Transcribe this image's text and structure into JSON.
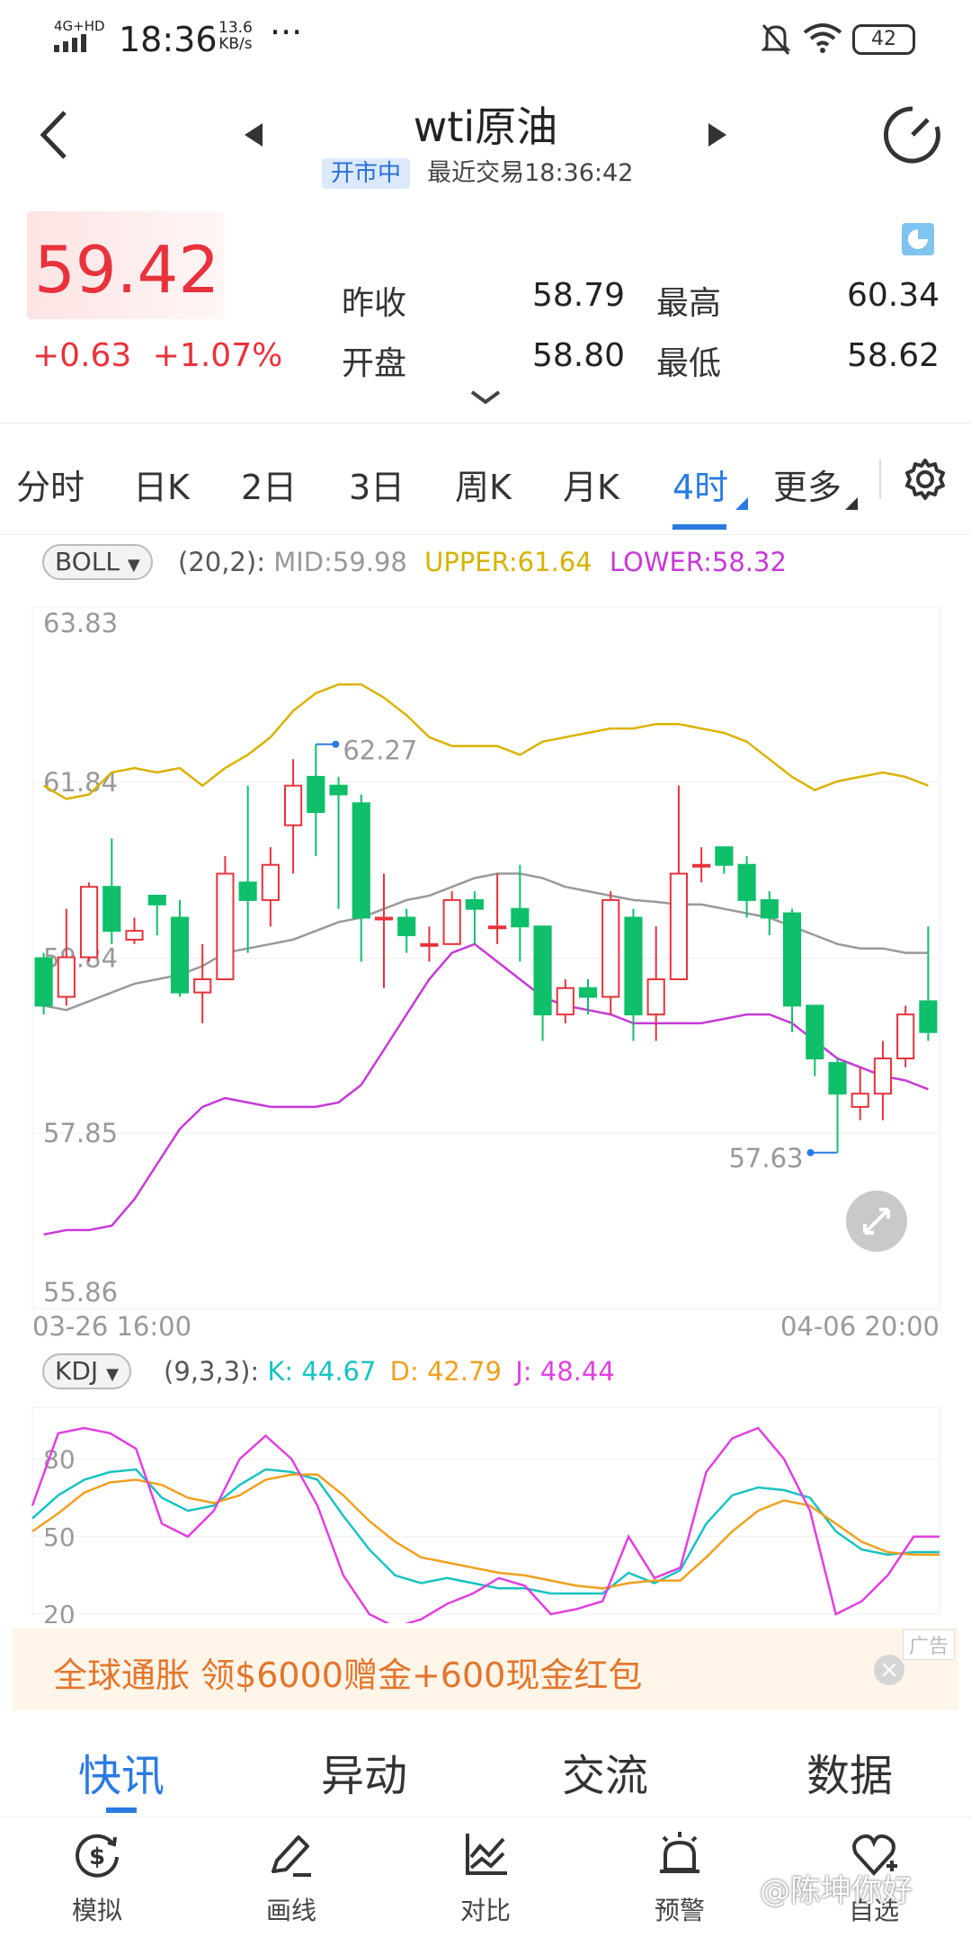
{
  "status_bar": {
    "network": "4G+HD",
    "time": "18:36",
    "speed_value": "13.6",
    "speed_unit": "KB/s",
    "more": "···",
    "battery": "42"
  },
  "header": {
    "title": "wti原油",
    "market_status": "开市中",
    "last_trade": "最近交易18:36:42"
  },
  "quote": {
    "price": "59.42",
    "change": "+0.63",
    "change_pct": "+1.07%",
    "prev_close_label": "昨收",
    "prev_close": "58.79",
    "high_label": "最高",
    "high": "60.34",
    "open_label": "开盘",
    "open": "58.80",
    "low_label": "最低",
    "low": "58.62"
  },
  "period_tabs": [
    "分时",
    "日K",
    "2日",
    "3日",
    "周K",
    "月K",
    "4时",
    "更多"
  ],
  "active_period": 6,
  "boll": {
    "indicator": "BOLL",
    "params": "(20,2):",
    "mid": "MID:59.98",
    "upper": "UPPER:61.64",
    "lower": "LOWER:58.32",
    "y_labels": [
      "63.83",
      "61.84",
      "59.84",
      "57.85",
      "55.86"
    ],
    "max_label": "62.27",
    "min_label": "57.63",
    "start_time": "03-26 16:00",
    "end_time": "04-06 20:00"
  },
  "kdj": {
    "indicator": "KDJ",
    "params": "(9,3,3):",
    "k": "K: 44.67",
    "d": "D: 42.79",
    "j": "J: 48.44",
    "y_labels": [
      "80",
      "50",
      "20"
    ]
  },
  "ad": {
    "text": "全球通胀 领$6000赠金+600现金红包",
    "tag": "广告"
  },
  "news_tabs": [
    "快讯",
    "异动",
    "交流",
    "数据"
  ],
  "toolbar": [
    {
      "label": "模拟",
      "icon": "dollar-refresh-icon"
    },
    {
      "label": "画线",
      "icon": "pencil-icon"
    },
    {
      "label": "对比",
      "icon": "compare-chart-icon"
    },
    {
      "label": "预警",
      "icon": "alarm-bell-icon"
    },
    {
      "label": "自选",
      "icon": "heart-plus-icon"
    }
  ],
  "watermark": "@陈坤你好",
  "colors": {
    "up": "#e8323c",
    "down": "#0fbf6a",
    "accent": "#2a7ae2",
    "upper": "#d9b300",
    "lower": "#c63ad6",
    "mid": "#999999",
    "k": "#19c2c2",
    "d": "#f0a020",
    "j": "#e040e0"
  },
  "chart_data": [
    {
      "type": "candlestick",
      "title": "wti原油 4时 BOLL(20,2)",
      "ylim": [
        55.86,
        63.83
      ],
      "y_ticks": [
        63.83,
        61.84,
        59.84,
        57.85,
        55.86
      ],
      "x_start": "03-26 16:00",
      "x_end": "04-06 20:00",
      "candles": [
        [
          59.84,
          59.3,
          59.9,
          59.2
        ],
        [
          59.4,
          59.85,
          60.4,
          59.3
        ],
        [
          59.85,
          60.65,
          60.7,
          59.8
        ],
        [
          60.65,
          60.15,
          61.2,
          60.0
        ],
        [
          60.05,
          60.15,
          60.3,
          60.0
        ],
        [
          60.55,
          60.45,
          60.55,
          60.1
        ],
        [
          60.3,
          59.45,
          60.5,
          59.4
        ],
        [
          59.45,
          59.6,
          60.0,
          59.1
        ],
        [
          59.6,
          60.8,
          61.0,
          59.6
        ],
        [
          60.7,
          60.5,
          61.8,
          59.9
        ],
        [
          60.5,
          60.9,
          61.1,
          60.2
        ],
        [
          61.35,
          61.8,
          62.1,
          60.8
        ],
        [
          61.9,
          61.5,
          62.27,
          61.0
        ],
        [
          61.8,
          61.7,
          61.9,
          60.4
        ],
        [
          61.6,
          60.3,
          61.7,
          59.8
        ],
        [
          60.3,
          60.3,
          60.8,
          59.5
        ],
        [
          60.3,
          60.1,
          60.4,
          59.9
        ],
        [
          60.0,
          60.0,
          60.2,
          59.8
        ],
        [
          60.0,
          60.5,
          60.6,
          60.0
        ],
        [
          60.5,
          60.4,
          60.6,
          60.0
        ],
        [
          60.2,
          60.2,
          60.8,
          60.0
        ],
        [
          60.4,
          60.2,
          60.9,
          59.8
        ],
        [
          60.2,
          59.2,
          60.2,
          58.9
        ],
        [
          59.2,
          59.5,
          59.6,
          59.1
        ],
        [
          59.5,
          59.4,
          59.6,
          59.2
        ],
        [
          59.4,
          60.5,
          60.6,
          59.2
        ],
        [
          60.3,
          59.2,
          60.4,
          58.9
        ],
        [
          59.2,
          59.6,
          60.2,
          58.9
        ],
        [
          59.6,
          60.8,
          61.8,
          59.6
        ],
        [
          60.9,
          60.9,
          61.1,
          60.7
        ],
        [
          61.1,
          60.9,
          61.1,
          60.8
        ],
        [
          60.9,
          60.5,
          61.0,
          60.3
        ],
        [
          60.5,
          60.3,
          60.6,
          60.1
        ],
        [
          60.35,
          59.3,
          60.4,
          59.0
        ],
        [
          59.3,
          58.7,
          59.3,
          58.5
        ],
        [
          58.65,
          58.3,
          58.7,
          57.63
        ],
        [
          58.15,
          58.3,
          58.6,
          58.0
        ],
        [
          58.3,
          58.7,
          58.9,
          58.0
        ],
        [
          58.7,
          59.2,
          59.3,
          58.6
        ],
        [
          59.35,
          59.0,
          60.2,
          58.9
        ]
      ],
      "upper": [
        61.8,
        61.65,
        61.7,
        61.95,
        62.0,
        61.95,
        62.0,
        61.8,
        62.0,
        62.15,
        62.35,
        62.65,
        62.85,
        62.95,
        62.95,
        62.8,
        62.6,
        62.35,
        62.25,
        62.25,
        62.25,
        62.15,
        62.3,
        62.35,
        62.4,
        62.45,
        62.45,
        62.5,
        62.5,
        62.45,
        62.4,
        62.3,
        62.1,
        61.9,
        61.75,
        61.85,
        61.9,
        61.95,
        61.9,
        61.8
      ],
      "mid": [
        59.3,
        59.25,
        59.35,
        59.45,
        59.55,
        59.6,
        59.65,
        59.75,
        59.9,
        59.95,
        60.0,
        60.05,
        60.15,
        60.25,
        60.3,
        60.4,
        60.5,
        60.55,
        60.65,
        60.75,
        60.8,
        60.8,
        60.75,
        60.65,
        60.6,
        60.55,
        60.5,
        60.48,
        60.45,
        60.45,
        60.4,
        60.35,
        60.3,
        60.2,
        60.1,
        60.0,
        59.95,
        59.95,
        59.9,
        59.9
      ],
      "lower": [
        56.7,
        56.75,
        56.75,
        56.8,
        57.1,
        57.5,
        57.9,
        58.15,
        58.25,
        58.2,
        58.15,
        58.15,
        58.15,
        58.2,
        58.4,
        58.8,
        59.2,
        59.6,
        59.9,
        60.0,
        59.8,
        59.6,
        59.4,
        59.3,
        59.25,
        59.2,
        59.1,
        59.1,
        59.1,
        59.1,
        59.15,
        59.2,
        59.2,
        59.1,
        58.9,
        58.7,
        58.6,
        58.5,
        58.45,
        58.35
      ]
    },
    {
      "type": "line",
      "title": "KDJ(9,3,3)",
      "ylim": [
        20,
        100
      ],
      "y_ticks": [
        80,
        50,
        20
      ],
      "series": [
        {
          "name": "K",
          "values": [
            57,
            66,
            72,
            75,
            76,
            65,
            60,
            62,
            70,
            76,
            75,
            72,
            58,
            45,
            35,
            32,
            34,
            32,
            30,
            30,
            28,
            28,
            28,
            36,
            32,
            37,
            55,
            66,
            69,
            68,
            65,
            52,
            45,
            43,
            44,
            44
          ]
        },
        {
          "name": "D",
          "values": [
            52,
            59,
            67,
            71,
            72,
            70,
            65,
            63,
            66,
            72,
            74,
            74,
            66,
            56,
            48,
            42,
            40,
            38,
            36,
            35,
            33,
            31,
            30,
            32,
            33,
            33,
            42,
            52,
            60,
            64,
            62,
            55,
            48,
            44,
            43,
            43
          ]
        },
        {
          "name": "J",
          "values": [
            62,
            90,
            92,
            90,
            84,
            55,
            50,
            60,
            80,
            89,
            80,
            62,
            35,
            20,
            15,
            18,
            24,
            28,
            34,
            31,
            20,
            22,
            25,
            50,
            34,
            38,
            75,
            88,
            92,
            80,
            60,
            20,
            25,
            35,
            50,
            50
          ]
        }
      ]
    }
  ]
}
